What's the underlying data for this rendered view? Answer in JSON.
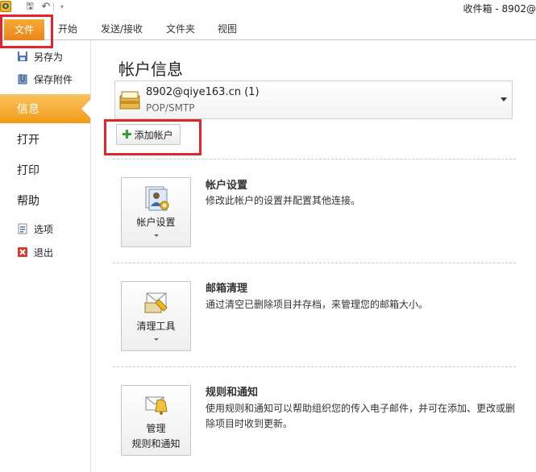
{
  "window": {
    "title": "收件箱 - 8902@"
  },
  "quick_access": {
    "app_icon_text": "O",
    "save_glyph": "🖫",
    "undo_glyph": "↶",
    "more_glyph": "▾"
  },
  "ribbon": {
    "tabs": [
      {
        "label": "文件"
      },
      {
        "label": "开始"
      },
      {
        "label": "发送/接收"
      },
      {
        "label": "文件夹"
      },
      {
        "label": "视图"
      }
    ]
  },
  "leftmenu": {
    "save_as": "另存为",
    "save_attachments": "保存附件",
    "info": "信息",
    "open": "打开",
    "print": "打印",
    "help": "帮助",
    "options": "选项",
    "exit": "退出"
  },
  "main": {
    "title": "帐户信息",
    "account": {
      "name": "8902@qiye163.cn (1)",
      "type": "POP/SMTP"
    },
    "add_account": "添加帐户",
    "sections": [
      {
        "button_label": "帐户设置",
        "title": "帐户设置",
        "description": "修改此帐户的设置并配置其他连接。"
      },
      {
        "button_label": "清理工具",
        "title": "邮箱清理",
        "description": "通过清空已删除项目并存档，来管理您的邮箱大小。"
      },
      {
        "button_label_line1": "管理",
        "button_label_line2": "规则和通知",
        "title": "规则和通知",
        "description": "使用规则和通知可以帮助组织您的传入电子邮件，并可在添加、更改或删除项目时收到更新。"
      }
    ]
  },
  "colors": {
    "accent_orange": "#f39a17",
    "highlight_red": "#e0262c"
  }
}
